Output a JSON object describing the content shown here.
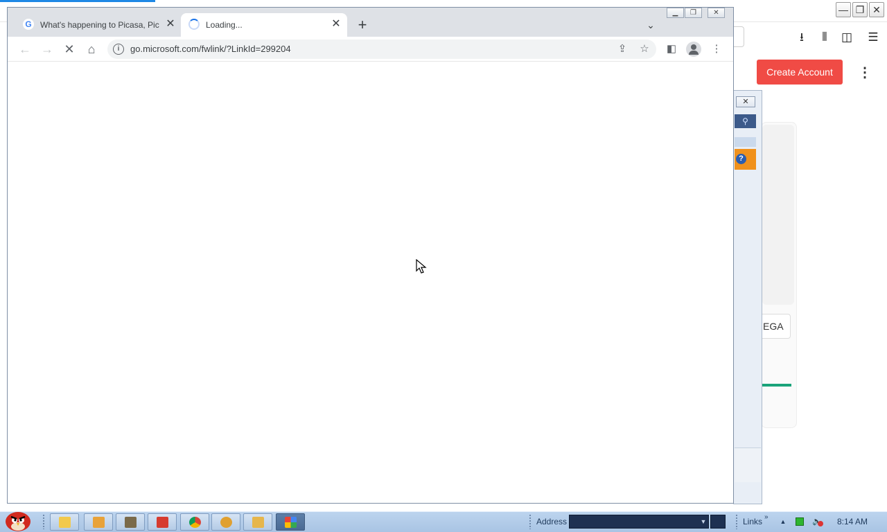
{
  "chrome": {
    "tabs": [
      {
        "title": "What's happening to Picasa, Pica",
        "icon": "google-icon",
        "active": false
      },
      {
        "title": "Loading...",
        "icon": "loading-spinner-icon",
        "active": true
      }
    ],
    "url": "go.microsoft.com/fwlink/?LinkId=299204",
    "icons": {
      "back": "back-arrow-icon",
      "forward": "forward-arrow-icon",
      "stop": "stop-loading-icon",
      "home": "home-icon",
      "share": "share-icon",
      "bookmark": "star-icon",
      "side_panel": "side-panel-icon",
      "profile": "profile-icon",
      "menu": "kebab-menu-icon"
    }
  },
  "background_page": {
    "create_account_label": "Create Account",
    "ega_button_label": "EGA",
    "accent_color": "#f04b45"
  },
  "taskbar": {
    "address_label": "Address",
    "links_label": "Links",
    "links_chevron": "»",
    "clock": "8:14 AM"
  }
}
